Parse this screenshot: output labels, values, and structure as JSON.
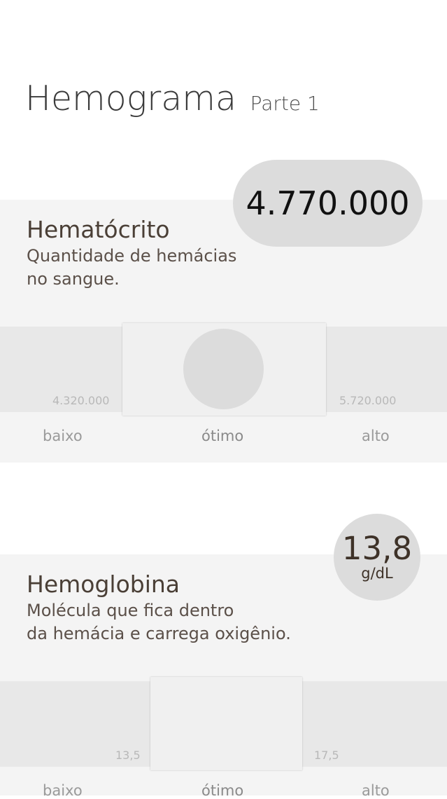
{
  "header": {
    "title": "Hemograma",
    "subtitle": "Parte 1"
  },
  "metrics": [
    {
      "name": "Hematócrito",
      "description": "Quantidade de hemácias\nno sangue.",
      "value": "4.770.000",
      "unit": "",
      "low_threshold": "4.320.000",
      "high_threshold": "5.720.000",
      "labels": {
        "low": "baixo",
        "optimal": "ótimo",
        "high": "alto"
      }
    },
    {
      "name": "Hemoglobina",
      "description": "Molécula que fica dentro\nda hemácia e carrega oxigênio.",
      "value": "13,8",
      "unit": "g/dL",
      "low_threshold": "13,5",
      "high_threshold": "17,5",
      "labels": {
        "low": "baixo",
        "optimal": "ótimo",
        "high": "alto"
      }
    }
  ],
  "colors": {
    "card_background": "#f4f4f4",
    "range_strip": "#e8e8e8",
    "value_badge": "#dcdcdc",
    "text_primary": "#4a3f36"
  }
}
